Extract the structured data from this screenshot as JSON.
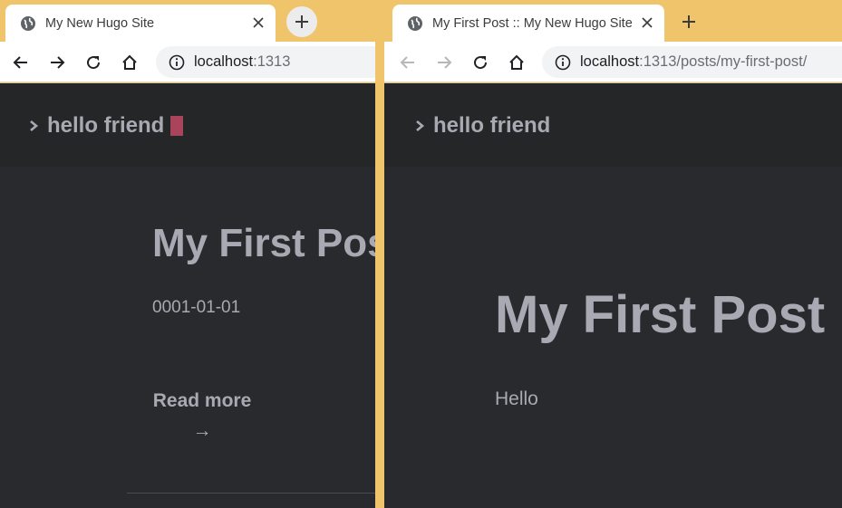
{
  "colors": {
    "desktop_bg": "#f0c46a",
    "page_bg": "#292a2d",
    "header_bg": "#252627",
    "text": "#a9a9b3",
    "cursor": "#a9445c"
  },
  "left_window": {
    "tab": {
      "title": "My New Hugo Site",
      "favicon": "globe-icon",
      "close_icon": "close-icon"
    },
    "new_tab_icon": "plus-icon",
    "toolbar": {
      "back_icon": "back-arrow-icon",
      "forward_icon": "forward-arrow-icon",
      "reload_icon": "reload-icon",
      "home_icon": "home-icon",
      "url_host": "localhost",
      "url_rest": ":1313"
    },
    "page": {
      "logo_text": "hello friend",
      "post_title": "My First Post",
      "post_date": "0001-01-01",
      "read_more_label": "Read more →"
    }
  },
  "right_window": {
    "tab": {
      "title": "My First Post :: My New Hugo Site",
      "favicon": "globe-icon",
      "close_icon": "close-icon"
    },
    "new_tab_icon": "plus-icon",
    "toolbar": {
      "back_icon": "back-arrow-icon",
      "forward_icon": "forward-arrow-icon",
      "reload_icon": "reload-icon",
      "home_icon": "home-icon",
      "url_host": "localhost",
      "url_rest": ":1313/posts/my-first-post/"
    },
    "page": {
      "logo_text": "hello friend",
      "post_title": "My First Post",
      "post_body": "Hello"
    }
  }
}
